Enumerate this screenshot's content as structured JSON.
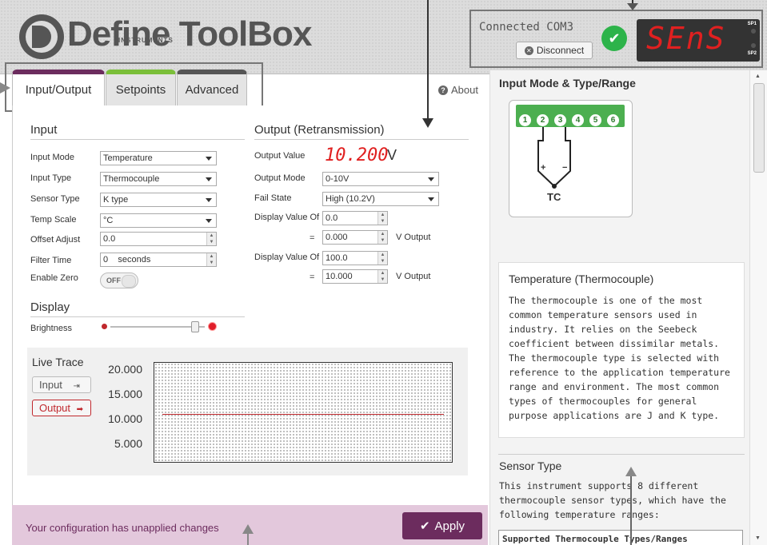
{
  "app": {
    "logo": "Define ToolBox",
    "logo_sub": "INSTRUMENTS"
  },
  "connection": {
    "status": "Connected  COM3",
    "disconnect": "Disconnect",
    "display": "SEnS",
    "sp1": "SP1",
    "sp2": "SP2"
  },
  "tabs": [
    {
      "label": "Input/Output"
    },
    {
      "label": "Setpoints"
    },
    {
      "label": "Advanced"
    }
  ],
  "about": "About",
  "input": {
    "title": "Input",
    "fields": [
      {
        "label": "Input Mode",
        "value": "Temperature"
      },
      {
        "label": "Input Type",
        "value": "Thermocouple"
      },
      {
        "label": "Sensor Type",
        "value": "K type"
      },
      {
        "label": "Temp Scale",
        "value": "°C"
      },
      {
        "label": "Offset Adjust",
        "value": "0.0"
      },
      {
        "label": "Filter Time",
        "value": "0",
        "suffix": "seconds"
      },
      {
        "label": "Enable Zero",
        "value": "OFF"
      }
    ]
  },
  "output": {
    "title": "Output (Retransmission)",
    "value_label": "Output Value",
    "value": "10.200",
    "unit": "V",
    "mode_label": "Output Mode",
    "mode": "0-10V",
    "fail_label": "Fail State",
    "fail": "High (10.2V)",
    "disp1_label": "Display Value Of",
    "disp1": "0.0",
    "eq1": "=",
    "out1": "0.000",
    "out_suffix": "V Output",
    "disp2_label": "Display Value Of",
    "disp2": "100.0",
    "eq2": "=",
    "out2": "10.000"
  },
  "display": {
    "title": "Display",
    "brightness_label": "Brightness",
    "brightness": 0.9
  },
  "trace": {
    "title": "Live Trace",
    "input_btn": "Input",
    "output_btn": "Output",
    "ticks": [
      "20.000",
      "15.000",
      "10.000",
      "5.000"
    ],
    "level": 11.2
  },
  "footer": {
    "message": "Your configuration has unapplied changes",
    "apply": "Apply"
  },
  "panel": {
    "title": "Input Mode & Type/Range",
    "terminals": [
      "1",
      "2",
      "3",
      "4",
      "5",
      "6"
    ],
    "tc_label": "TC",
    "plus": "+",
    "minus": "−",
    "desc_title": "Temperature (Thermocouple)",
    "desc_body": "The thermocouple is one of the most common temperature sensors used in industry. It relies on the Seebeck coefficient between dissimilar metals. The thermocouple type is selected with reference to the application temperature range and environment. The most common types of thermocouples for general purpose applications are J and K type.",
    "sensor_title": "Sensor Type",
    "sensor_body": "This instrument supports 8 different thermocouple sensor types, which have the following temperature ranges:",
    "table_header": "Supported Thermocouple Types/Ranges"
  },
  "colors": {
    "brand": "#6c2c5e",
    "green": "#2db34a",
    "red": "#e02020"
  }
}
